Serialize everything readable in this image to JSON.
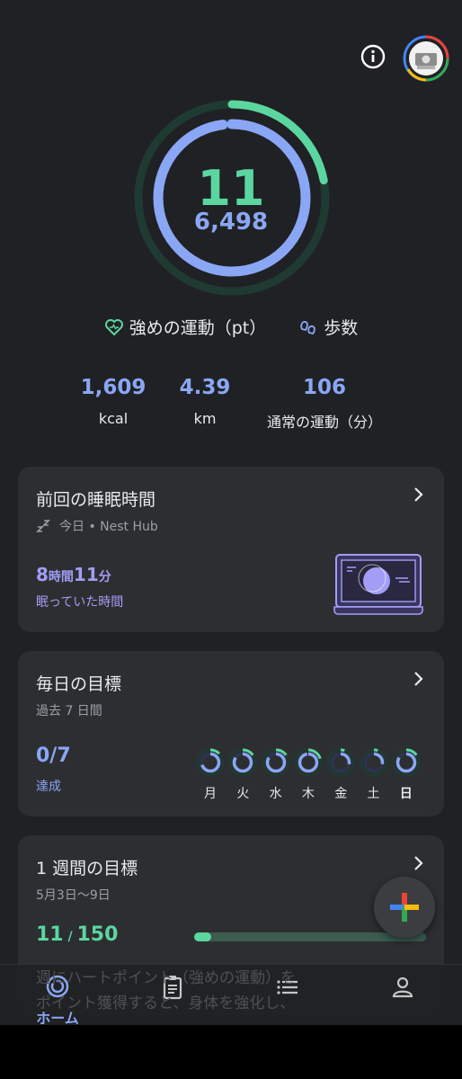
{
  "header": {
    "info_icon": "info-icon",
    "avatar_icon": "profile-avatar"
  },
  "summary": {
    "heart_points": "11",
    "steps": "6,498",
    "heart_points_progress": 0.22,
    "steps_progress": 0.98,
    "legend_heart": "強めの運動（pt）",
    "legend_steps": "歩数",
    "colors": {
      "heart": "#5bd6a0",
      "steps": "#8aa7f5"
    }
  },
  "stats": [
    {
      "value": "1,609",
      "label": "kcal"
    },
    {
      "value": "4.39",
      "label": "km"
    },
    {
      "value": "106",
      "label": "通常の運動（分）"
    }
  ],
  "sleep_card": {
    "title": "前回の睡眠時間",
    "subtitle": "今日 • Nest Hub",
    "hours": "8",
    "hours_unit": "時間",
    "minutes": "11",
    "minutes_unit": "分",
    "label": "眠っていた時間"
  },
  "daily_goals_card": {
    "title": "毎日の目標",
    "subtitle": "過去 7 日間",
    "value": "0/7",
    "label": "達成",
    "days": [
      {
        "label": "月",
        "progress": 0.25
      },
      {
        "label": "火",
        "progress": 0.3
      },
      {
        "label": "水",
        "progress": 0.3
      },
      {
        "label": "木",
        "progress": 0.4
      },
      {
        "label": "金",
        "progress": 0.1
      },
      {
        "label": "土",
        "progress": 0.1
      },
      {
        "label": "日",
        "progress": 0.3
      }
    ]
  },
  "weekly_goal_card": {
    "title": "1 週間の目標",
    "subtitle": "5月3日〜9日",
    "value": "11",
    "target": "150",
    "progress": 0.073
  },
  "ghost_text": [
    "週にハートポイント（強めの運動）を",
    "ポイント獲得すると、身体を強化し、"
  ],
  "bottom_nav": [
    {
      "label": "ホーム",
      "icon": "home-ring-icon"
    },
    {
      "label": "",
      "icon": "journal-icon"
    },
    {
      "label": "",
      "icon": "browse-icon"
    },
    {
      "label": "",
      "icon": "profile-icon"
    }
  ]
}
